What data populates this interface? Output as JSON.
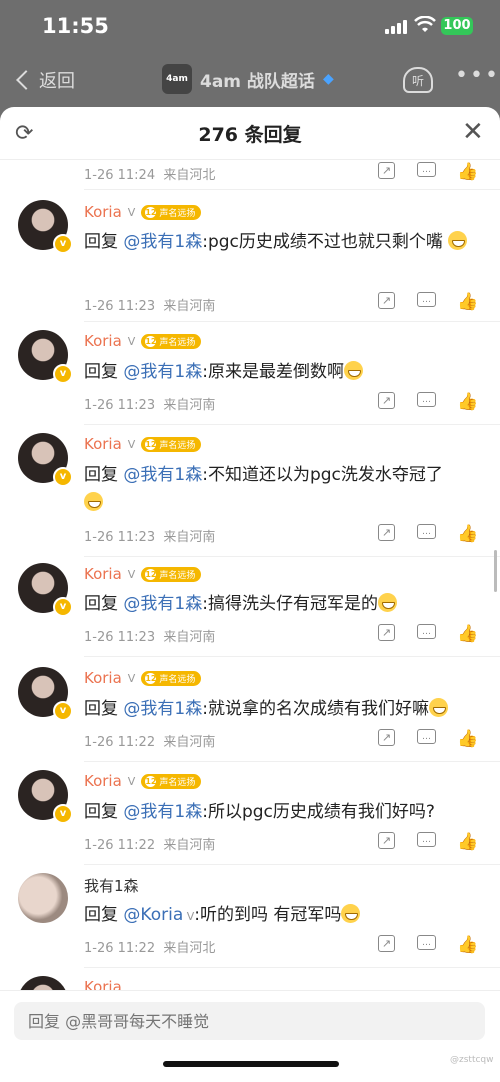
{
  "status": {
    "time": "11:55",
    "battery": "100"
  },
  "nav": {
    "back_label": "返回",
    "topic_logo": "4am",
    "topic": "4am 战队超话",
    "listen_label": "听",
    "more_label": "•••"
  },
  "sheet": {
    "title": "276 条回复"
  },
  "level_badge": {
    "num": "12",
    "text": "声名远扬"
  },
  "comments": [
    {
      "name": "",
      "text": "",
      "time": "1-26 11:24",
      "loc": "来自河北"
    },
    {
      "name": "Koria",
      "text_pre": "回复 ",
      "mention": "@我有1森",
      "text_post": ":pgc历史成绩不过也就只剩个嘴",
      "time": "1-26 11:23",
      "loc": "来自河南"
    },
    {
      "name": "Koria",
      "text_pre": "回复 ",
      "mention": "@我有1森",
      "text_post": ":原来是最差倒数啊",
      "time": "1-26 11:23",
      "loc": "来自河南"
    },
    {
      "name": "Koria",
      "text_pre": "回复 ",
      "mention": "@我有1森",
      "text_post": ":不知道还以为pgc洗发水夺冠了",
      "time": "1-26 11:23",
      "loc": "来自河南"
    },
    {
      "name": "Koria",
      "text_pre": "回复 ",
      "mention": "@我有1森",
      "text_post": ":搞得洗头仔有冠军是的",
      "time": "1-26 11:23",
      "loc": "来自河南"
    },
    {
      "name": "Koria",
      "text_pre": "回复 ",
      "mention": "@我有1森",
      "text_post": ":就说拿的名次成绩有我们好嘛",
      "time": "1-26 11:22",
      "loc": "来自河南"
    },
    {
      "name": "Koria",
      "text_pre": "回复 ",
      "mention": "@我有1森",
      "text_post": ":所以pgc历史成绩有我们好吗?",
      "time": "1-26 11:22",
      "loc": "来自河南"
    },
    {
      "name": "我有1森",
      "text_pre": "回复 ",
      "mention": "@Koria",
      "text_post": ":听的到吗 有冠军吗",
      "time": "1-26 11:22",
      "loc": "来自河北"
    },
    {
      "name": "Koria"
    }
  ],
  "input": {
    "placeholder": "回复 @黑哥哥每天不睡觉"
  },
  "watermark": "@zsttcqw"
}
